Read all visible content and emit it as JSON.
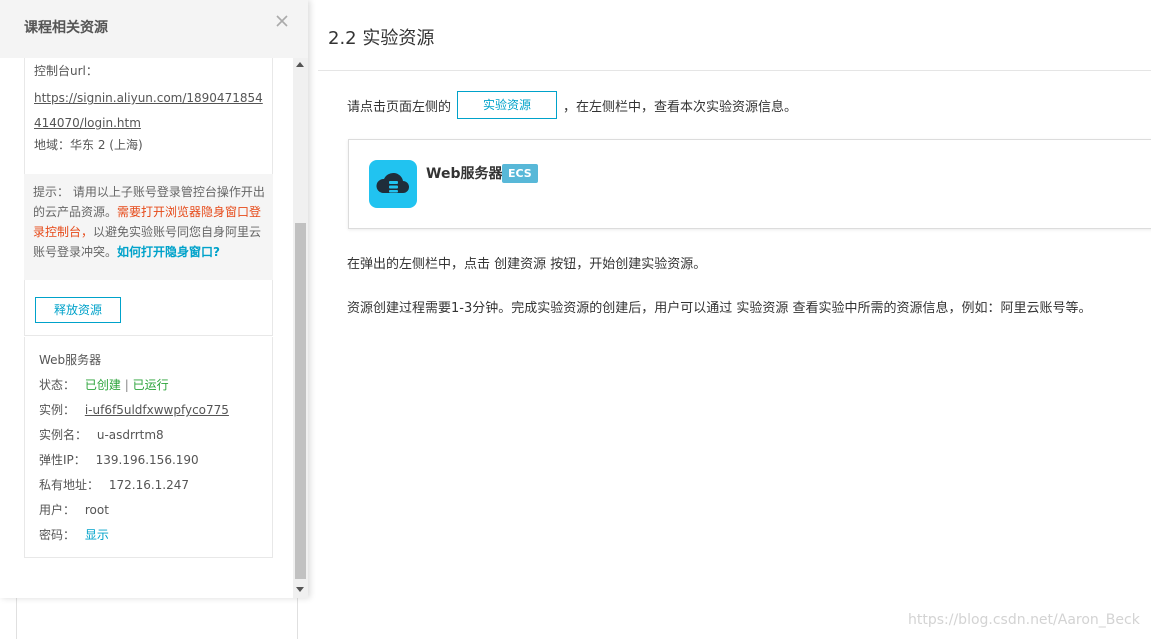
{
  "main": {
    "section_title": "2.2 实验资源",
    "instruction_prefix": "请点击页面左侧的",
    "resource_button": "实验资源",
    "instruction_suffix": "，在左侧栏中，查看本次实验资源信息。",
    "server_card": {
      "name": "Web服务器",
      "badge": "ECS",
      "icon": "cloud-server-icon"
    },
    "line2": "在弹出的左侧栏中，点击 创建资源 按钮，开始创建实验资源。",
    "line3": "资源创建过程需要1-3分钟。完成实验资源的创建后，用户可以通过 实验资源 查看实验中所需的资源信息，例如：阿里云账号等。",
    "watermark": "https://blog.csdn.net/Aaron_Beck"
  },
  "side_panel": {
    "title": "课程相关资源",
    "close_icon": "close-icon",
    "console_label": "控制台url：",
    "console_url": "https://signin.aliyun.com/1890471854414070/login.htm",
    "region": "地域：华东 2 (上海)",
    "tip": {
      "prefix": "提示： 请用以上子账号登录管控台操作开出的云产品资源。",
      "warning": "需要打开浏览器隐身窗口登录控制台，",
      "middle": "以避免实验账号同您自身阿里云账号登录冲突。",
      "link": "如何打开隐身窗口?"
    },
    "release_button": "释放资源",
    "resource_info": {
      "heading": "Web服务器",
      "status_label": "状态：",
      "status_created": "已创建",
      "status_sep": "|",
      "status_running": "已运行",
      "instance_label": "实例：",
      "instance_value": "i-uf6f5uldfxwwpfyco775",
      "instance_name_label": "实例名：",
      "instance_name_value": "u-asdrrtm8",
      "eip_label": "弹性IP：",
      "eip_value": "139.196.156.190",
      "private_label": "私有地址：",
      "private_value": "172.16.1.247",
      "user_label": "用户：",
      "user_value": "root",
      "password_label": "密码：",
      "password_value": "显示"
    }
  },
  "colors": {
    "accent": "#00a2ca",
    "warning": "#e64a19",
    "success": "#2ba33a",
    "icon_bg": "#21c3f0",
    "badge_bg": "#58b8d8"
  }
}
